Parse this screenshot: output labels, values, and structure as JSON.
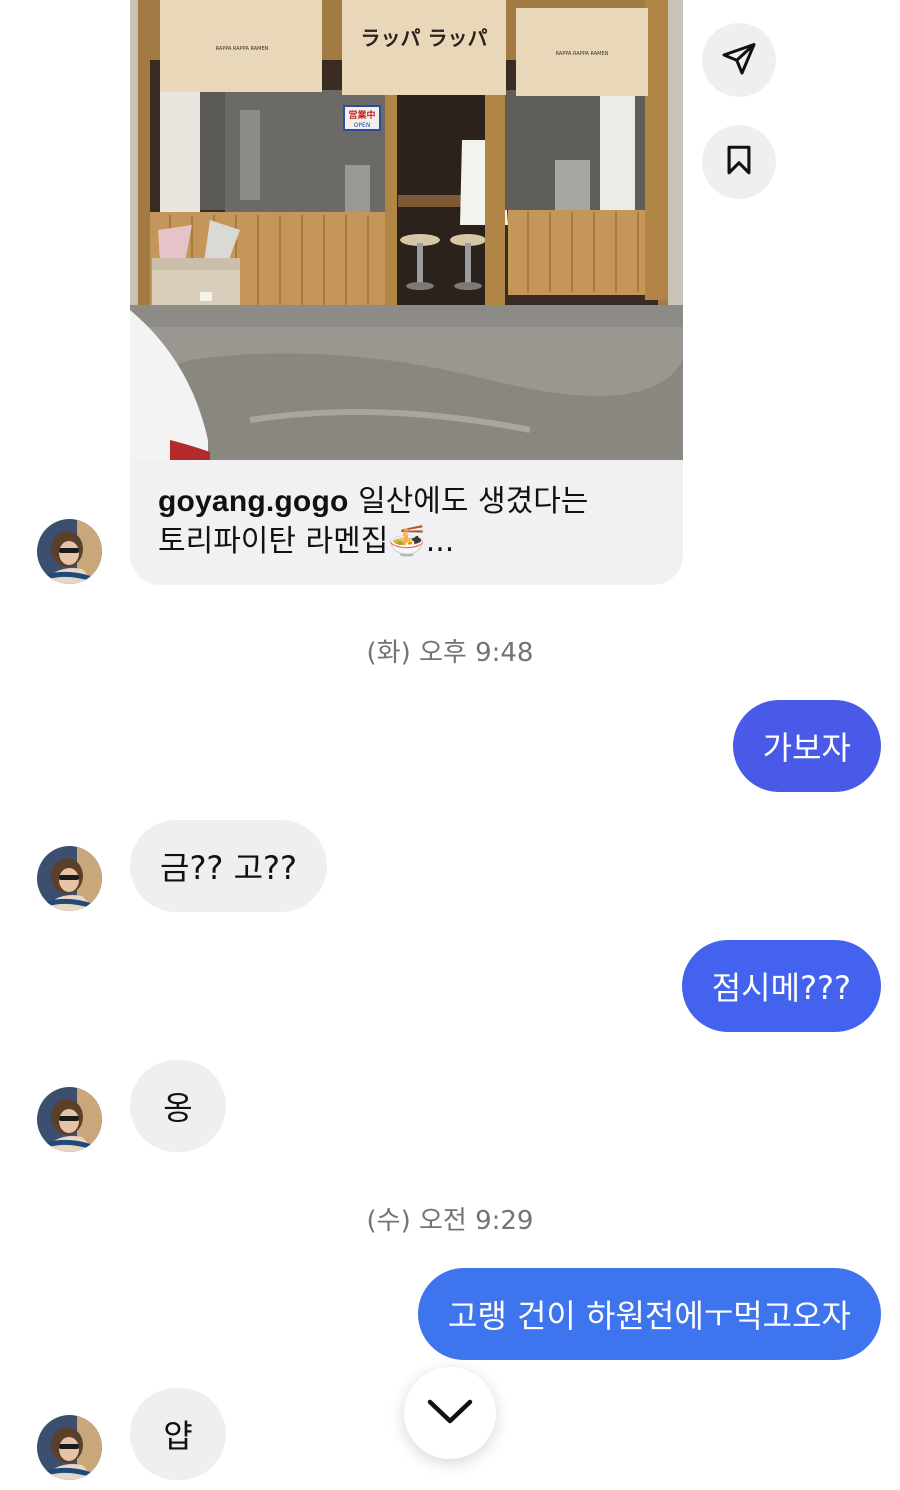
{
  "post": {
    "username": "goyang.gogo",
    "caption_line1": "일산에도 생겼다는",
    "caption_line2": "토리파이탄 라멘집🍜...",
    "image": {
      "curtain_center_text": "ラッパ ラッパ",
      "curtain_side_text": "RAPPA RAPPA RAMEN",
      "open_sign": "営業中",
      "open_sign_sub": "OPEN"
    }
  },
  "actions": {
    "share_icon": "paper-plane-icon",
    "save_icon": "bookmark-icon"
  },
  "messages": [
    {
      "type": "timestamp",
      "text": "(화) 오후 9:48"
    },
    {
      "type": "outgoing",
      "text": "가보자",
      "color": "#4a5ae8"
    },
    {
      "type": "incoming",
      "text": "금?? 고??"
    },
    {
      "type": "outgoing",
      "text": "점시메???",
      "color": "#4362ee"
    },
    {
      "type": "incoming",
      "text": "옹"
    },
    {
      "type": "timestamp",
      "text": "(수) 오전 9:29"
    },
    {
      "type": "outgoing",
      "text": "고랭 건이 하원전에ㅜ먹고오자",
      "color": "#3f74ef"
    },
    {
      "type": "incoming",
      "text": "얍"
    }
  ],
  "scroll_down_icon": "chevron-down-icon",
  "colors": {
    "incoming_bubble": "#efeff0",
    "timestamp": "#737373"
  }
}
